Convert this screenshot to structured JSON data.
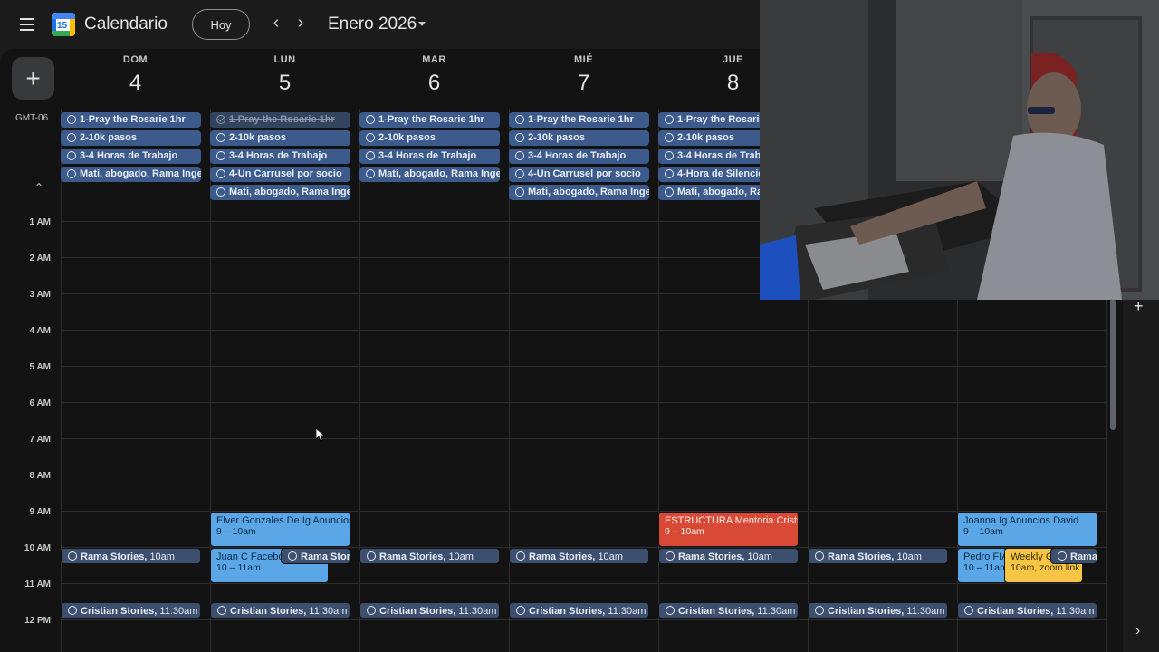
{
  "header": {
    "menu_icon": "menu-icon",
    "logo_number": "15",
    "app_title": "Calendario",
    "today_label": "Hoy",
    "prev_icon": "‹",
    "next_icon": "›",
    "month_label": "Enero 2026"
  },
  "grid": {
    "create_label": "+",
    "timezone": "GMT-06",
    "collapse_icon": "⌃",
    "days": [
      {
        "name": "DOM",
        "num": "4"
      },
      {
        "name": "LUN",
        "num": "5"
      },
      {
        "name": "MAR",
        "num": "6"
      },
      {
        "name": "MIÉ",
        "num": "7"
      },
      {
        "name": "JUE",
        "num": "8"
      },
      {
        "name": "",
        "num": ""
      },
      {
        "name": "",
        "num": ""
      }
    ],
    "hours": [
      "1 AM",
      "2 AM",
      "3 AM",
      "4 AM",
      "5 AM",
      "6 AM",
      "7 AM",
      "8 AM",
      "9 AM",
      "10 AM",
      "11 AM",
      "12 PM"
    ]
  },
  "allday": {
    "sun": [
      "1-Pray the Rosarie 1hr",
      "2-10k pasos",
      "3-4 Horas de Trabajo",
      "Mati, abogado, Rama Inger"
    ],
    "mon": [
      "1-Pray the Rosarie 1hr",
      "2-10k pasos",
      "3-4 Horas de Trabajo",
      "4-Un Carrusel por socio",
      "Mati, abogado, Rama Inger"
    ],
    "tue": [
      "1-Pray the Rosarie 1hr",
      "2-10k pasos",
      "3-4 Horas de Trabajo",
      "Mati, abogado, Rama Inger"
    ],
    "wed": [
      "1-Pray the Rosarie 1hr",
      "2-10k pasos",
      "3-4 Horas de Trabajo",
      "4-Un Carrusel por socio",
      "Mati, abogado, Rama Inger"
    ],
    "thu": [
      "1-Pray the Rosarie",
      "2-10k pasos",
      "3-4 Horas de Traba",
      "4-Hora de Silencio",
      "Mati, abogado, Ran"
    ]
  },
  "events": {
    "mon_elver": {
      "title": "Elver Gonzales De Ig Anuncios",
      "time": "9 – 10am"
    },
    "mon_juan": {
      "title": "Juan C Facebo",
      "time": "10 – 11am"
    },
    "mon_rama_small": "Rama Storie",
    "thu_estructura": {
      "title": "ESTRUCTURA Mentoria Cristian",
      "time": "9 – 10am"
    },
    "sat_joanna": {
      "title": "Joanna Ig Anuncios David",
      "time": "9 – 10am"
    },
    "sat_pedro": {
      "title": "Pedro FIA",
      "time": "10 – 11am"
    },
    "sat_weekly": {
      "title": "Weekly G",
      "time": "10am, zoom link w"
    },
    "sat_rama_small": "Rama",
    "rama_title": "Rama Stories,",
    "rama_time": "10am",
    "cristian_title": "Cristian Stories,",
    "cristian_time": "11:30am"
  },
  "sidebar": {
    "plus_icon": "+",
    "chevron_icon": "›"
  },
  "colors": {
    "task_chip": "#3d5a8c",
    "event_blue": "#5aa6e6",
    "event_red": "#d94a36",
    "event_yellow": "#f6c544"
  }
}
